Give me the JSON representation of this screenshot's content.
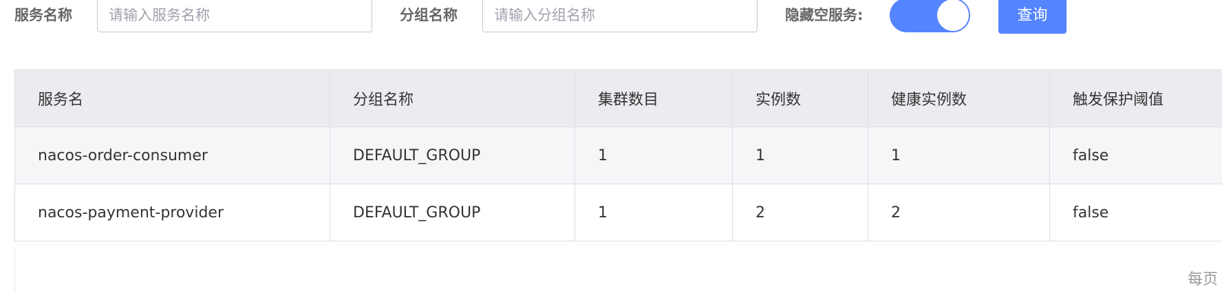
{
  "filters": {
    "service_name_label": "服务名称",
    "service_name_placeholder": "请输入服务名称",
    "service_name_value": "",
    "group_name_label": "分组名称",
    "group_name_placeholder": "请输入分组名称",
    "group_name_value": "",
    "hide_empty_label": "隐藏空服务:",
    "hide_empty_enabled": true,
    "query_label": "查询"
  },
  "table": {
    "columns": [
      "服务名",
      "分组名称",
      "集群数目",
      "实例数",
      "健康实例数",
      "触发保护阈值"
    ],
    "rows": [
      [
        "nacos-order-consumer",
        "DEFAULT_GROUP",
        "1",
        "1",
        "1",
        "false"
      ],
      [
        "nacos-payment-provider",
        "DEFAULT_GROUP",
        "1",
        "2",
        "2",
        "false"
      ]
    ]
  },
  "pagination": {
    "per_page_label": "每页"
  },
  "colors": {
    "accent": "#5584ff",
    "header_bg": "#ebecf0",
    "border": "#dcdee3"
  }
}
